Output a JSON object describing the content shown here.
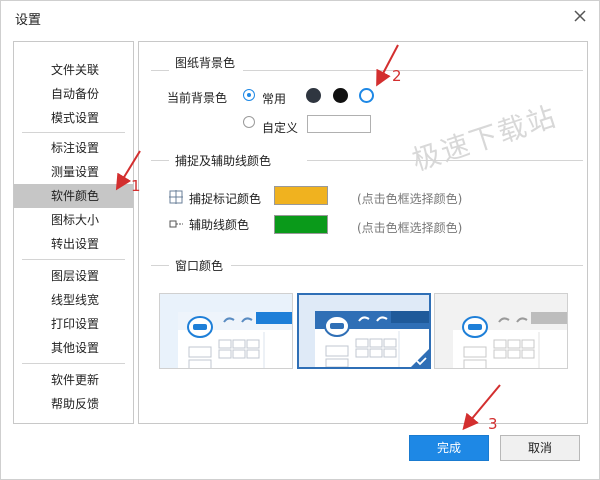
{
  "window": {
    "title": "设置"
  },
  "sidebar": {
    "items": [
      {
        "label": "文件关联"
      },
      {
        "label": "自动备份"
      },
      {
        "label": "模式设置"
      },
      {
        "label": "标注设置"
      },
      {
        "label": "测量设置"
      },
      {
        "label": "软件颜色",
        "active": true
      },
      {
        "label": "图标大小"
      },
      {
        "label": "转出设置"
      },
      {
        "label": "图层设置"
      },
      {
        "label": "线型线宽"
      },
      {
        "label": "打印设置"
      },
      {
        "label": "其他设置"
      },
      {
        "label": "软件更新"
      },
      {
        "label": "帮助反馈"
      }
    ]
  },
  "bg_section": {
    "title": "图纸背景色",
    "current_label": "当前背景色",
    "common_label": "常用",
    "custom_label": "自定义",
    "common_selected": true,
    "colors": [
      "#2f3640",
      "#111111",
      "#ffffff"
    ],
    "selected_color_index": 2
  },
  "capture_section": {
    "title": "捕捉及辅助线颜色",
    "mark_label": "捕捉标记颜色",
    "mark_color": "#f0b21f",
    "aux_label": "辅助线颜色",
    "aux_color": "#0a9a1a",
    "hint": "(点击色框选择颜色)"
  },
  "window_section": {
    "title": "窗口颜色",
    "themes": [
      {
        "name": "light-blue",
        "selected": false
      },
      {
        "name": "blue",
        "selected": true
      },
      {
        "name": "gray",
        "selected": false
      }
    ]
  },
  "watermark": "极速下载站",
  "buttons": {
    "ok": "完成",
    "cancel": "取消"
  },
  "annotations": [
    "1",
    "2",
    "3"
  ],
  "colors": {
    "accent": "#1e88e5",
    "annotation": "#d32f2f",
    "selected_theme_border": "#2f6fb6"
  }
}
